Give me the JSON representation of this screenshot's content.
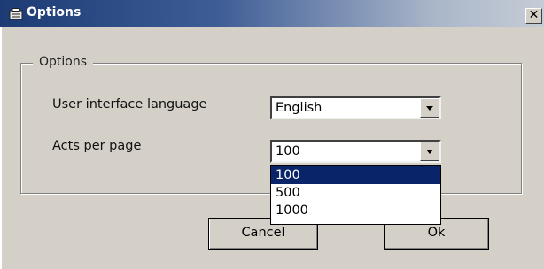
{
  "window": {
    "title": "Options",
    "icon": "options-dialog-icon"
  },
  "groupbox": {
    "legend": "Options"
  },
  "language": {
    "label": "User interface language",
    "value": "English"
  },
  "acts": {
    "label": "Acts per page",
    "value": "100",
    "options": [
      "100",
      "500",
      "1000"
    ],
    "highlighted": "100"
  },
  "buttons": {
    "cancel": "Cancel",
    "ok": "Ok"
  },
  "close_glyph": "✕",
  "colors": {
    "highlight": "#0a246a",
    "face": "#d4d0c8"
  }
}
